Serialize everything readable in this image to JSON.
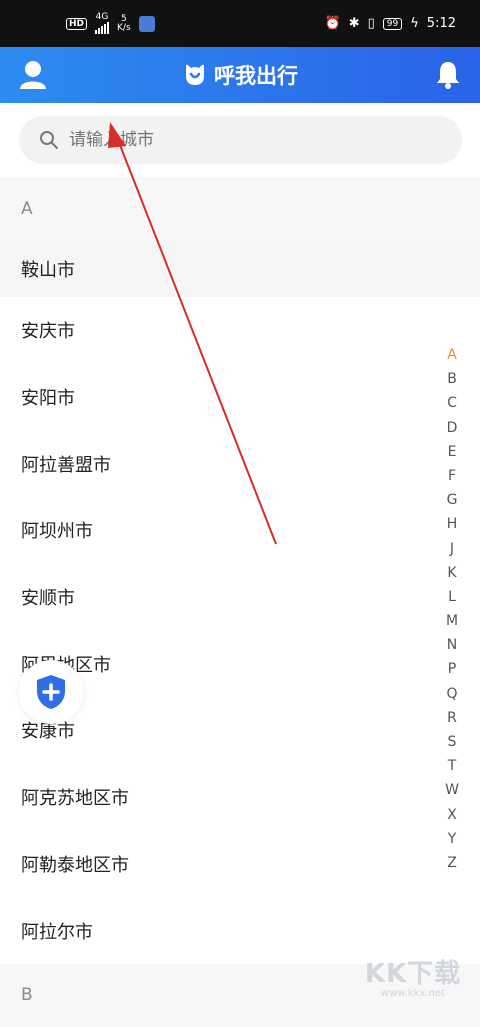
{
  "statusbar": {
    "network": "4G",
    "speed_value": "5",
    "speed_unit": "K/s",
    "battery": "99",
    "time": "5:12"
  },
  "header": {
    "title": "呼我出行",
    "bg_start": "#2d8cf0",
    "bg_end": "#2a63e8"
  },
  "search": {
    "placeholder": "请输入城市"
  },
  "sections": [
    {
      "letter": "A",
      "cities": [
        "鞍山市",
        "安庆市",
        "安阳市",
        "阿拉善盟市",
        "阿坝州市",
        "安顺市",
        "阿里地区市",
        "安康市",
        "阿克苏地区市",
        "阿勒泰地区市",
        "阿拉尔市"
      ]
    },
    {
      "letter": "B"
    }
  ],
  "index_letters": [
    "A",
    "B",
    "C",
    "D",
    "E",
    "F",
    "G",
    "H",
    "J",
    "K",
    "L",
    "M",
    "N",
    "P",
    "Q",
    "R",
    "S",
    "T",
    "W",
    "X",
    "Y",
    "Z"
  ],
  "index_active_color": "#f08c2c",
  "watermark": {
    "logo": "KK下载",
    "url": "www.kkx.net"
  }
}
